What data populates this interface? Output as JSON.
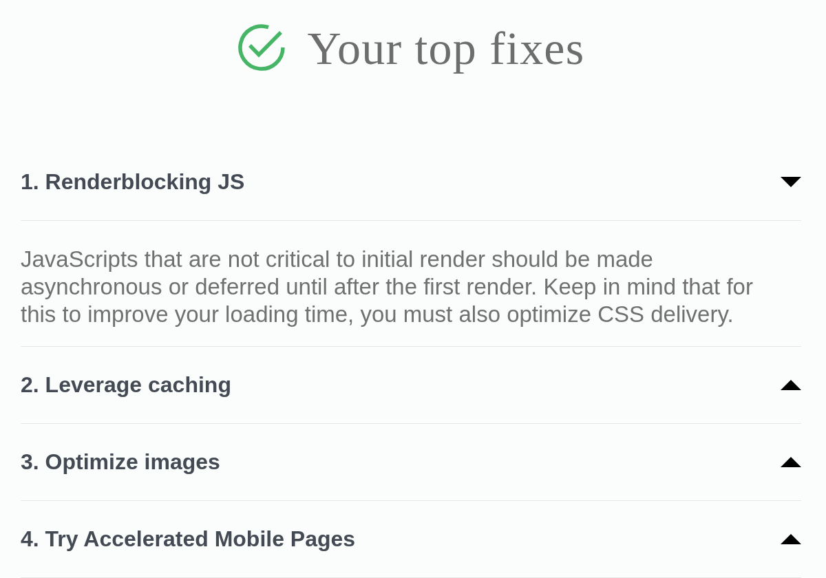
{
  "header": {
    "title": "Your top fixes"
  },
  "fixes": [
    {
      "title": "1. Renderblocking JS",
      "expanded": true,
      "description": "JavaScripts that are not critical to initial render should be made asynchronous or deferred until after the first render. Keep in mind that for this to improve your loading time, you must also optimize CSS delivery."
    },
    {
      "title": "2. Leverage caching",
      "expanded": false
    },
    {
      "title": "3. Optimize images",
      "expanded": false
    },
    {
      "title": "4. Try Accelerated Mobile Pages",
      "expanded": false
    }
  ]
}
